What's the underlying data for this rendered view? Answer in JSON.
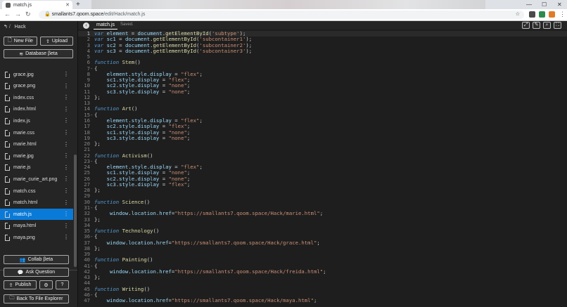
{
  "browser": {
    "tab_title": "match.js",
    "url_host": "smallants7.qoom.space",
    "url_path": "/edit/Hack/match.js"
  },
  "sidebar": {
    "breadcrumb": "Hack",
    "new_file": "New File",
    "upload": "Upload",
    "database": "Database βeta",
    "files": [
      "grace.jpg",
      "grace.png",
      "index.css",
      "index.html",
      "index.js",
      "marie.css",
      "marie.html",
      "marie.jpg",
      "marie.js",
      "marie_curie_art.png",
      "match.css",
      "match.html",
      "match.js",
      "maya.html",
      "maya.png"
    ],
    "active_file": "match.js",
    "collab": "Collab βeta",
    "ask": "Ask Question",
    "publish": "Publish",
    "back_explorer": "Back To File Explorer"
  },
  "editor": {
    "tab": "match.js",
    "status": "Saved.",
    "current_line": 1,
    "lines": [
      [
        [
          "kw",
          "var"
        ],
        [
          "pl",
          " "
        ],
        [
          "id",
          "element"
        ],
        [
          "pl",
          " = "
        ],
        [
          "id",
          "document"
        ],
        [
          "pl",
          "."
        ],
        [
          "fn",
          "getElementById"
        ],
        [
          "pl",
          "("
        ],
        [
          "str",
          "'subtype'"
        ],
        [
          "pl",
          ");"
        ]
      ],
      [
        [
          "kw",
          "var"
        ],
        [
          "pl",
          " "
        ],
        [
          "id",
          "sc1"
        ],
        [
          "pl",
          " = "
        ],
        [
          "id",
          "document"
        ],
        [
          "pl",
          "."
        ],
        [
          "fn",
          "getElementById"
        ],
        [
          "pl",
          "("
        ],
        [
          "str",
          "'subcontainer1'"
        ],
        [
          "pl",
          ");"
        ]
      ],
      [
        [
          "kw",
          "var"
        ],
        [
          "pl",
          " "
        ],
        [
          "id",
          "sc2"
        ],
        [
          "pl",
          " = "
        ],
        [
          "id",
          "document"
        ],
        [
          "pl",
          "."
        ],
        [
          "fn",
          "getElementById"
        ],
        [
          "pl",
          "("
        ],
        [
          "str",
          "'subcontainer2'"
        ],
        [
          "pl",
          ");"
        ]
      ],
      [
        [
          "kw",
          "var"
        ],
        [
          "pl",
          " "
        ],
        [
          "id",
          "sc3"
        ],
        [
          "pl",
          " = "
        ],
        [
          "id",
          "document"
        ],
        [
          "pl",
          "."
        ],
        [
          "fn",
          "getElementById"
        ],
        [
          "pl",
          "("
        ],
        [
          "str",
          "'subcontainer3'"
        ],
        [
          "pl",
          ");"
        ]
      ],
      [],
      [
        [
          "kw",
          "function"
        ],
        [
          "pl",
          " "
        ],
        [
          "fn",
          "Stem"
        ],
        [
          "pl",
          "()"
        ]
      ],
      [
        [
          "pl",
          "{"
        ]
      ],
      [
        [
          "pl",
          "    "
        ],
        [
          "id",
          "element"
        ],
        [
          "pl",
          "."
        ],
        [
          "id",
          "style"
        ],
        [
          "pl",
          "."
        ],
        [
          "id",
          "display"
        ],
        [
          "pl",
          " = "
        ],
        [
          "str",
          "\"flex\""
        ],
        [
          "pl",
          ";"
        ]
      ],
      [
        [
          "pl",
          "    "
        ],
        [
          "id",
          "sc1"
        ],
        [
          "pl",
          "."
        ],
        [
          "id",
          "style"
        ],
        [
          "pl",
          "."
        ],
        [
          "id",
          "display"
        ],
        [
          "pl",
          " = "
        ],
        [
          "str",
          "\"flex\""
        ],
        [
          "pl",
          ";"
        ]
      ],
      [
        [
          "pl",
          "    "
        ],
        [
          "id",
          "sc2"
        ],
        [
          "pl",
          "."
        ],
        [
          "id",
          "style"
        ],
        [
          "pl",
          "."
        ],
        [
          "id",
          "display"
        ],
        [
          "pl",
          " = "
        ],
        [
          "str",
          "\"none\""
        ],
        [
          "pl",
          ";"
        ]
      ],
      [
        [
          "pl",
          "    "
        ],
        [
          "id",
          "sc3"
        ],
        [
          "pl",
          "."
        ],
        [
          "id",
          "style"
        ],
        [
          "pl",
          "."
        ],
        [
          "id",
          "display"
        ],
        [
          "pl",
          " = "
        ],
        [
          "str",
          "\"none\""
        ],
        [
          "pl",
          ";"
        ]
      ],
      [
        [
          "pl",
          "};"
        ]
      ],
      [],
      [
        [
          "kw",
          "function"
        ],
        [
          "pl",
          " "
        ],
        [
          "fn",
          "Art"
        ],
        [
          "pl",
          "()"
        ]
      ],
      [
        [
          "pl",
          "{"
        ]
      ],
      [
        [
          "pl",
          "    "
        ],
        [
          "id",
          "element"
        ],
        [
          "pl",
          "."
        ],
        [
          "id",
          "style"
        ],
        [
          "pl",
          "."
        ],
        [
          "id",
          "display"
        ],
        [
          "pl",
          " = "
        ],
        [
          "str",
          "\"flex\""
        ],
        [
          "pl",
          ";"
        ]
      ],
      [
        [
          "pl",
          "    "
        ],
        [
          "id",
          "sc2"
        ],
        [
          "pl",
          "."
        ],
        [
          "id",
          "style"
        ],
        [
          "pl",
          "."
        ],
        [
          "id",
          "display"
        ],
        [
          "pl",
          " = "
        ],
        [
          "str",
          "\"flex\""
        ],
        [
          "pl",
          ";"
        ]
      ],
      [
        [
          "pl",
          "    "
        ],
        [
          "id",
          "sc1"
        ],
        [
          "pl",
          "."
        ],
        [
          "id",
          "style"
        ],
        [
          "pl",
          "."
        ],
        [
          "id",
          "display"
        ],
        [
          "pl",
          " = "
        ],
        [
          "str",
          "\"none\""
        ],
        [
          "pl",
          ";"
        ]
      ],
      [
        [
          "pl",
          "    "
        ],
        [
          "id",
          "sc3"
        ],
        [
          "pl",
          "."
        ],
        [
          "id",
          "style"
        ],
        [
          "pl",
          "."
        ],
        [
          "id",
          "display"
        ],
        [
          "pl",
          " = "
        ],
        [
          "str",
          "\"none\""
        ],
        [
          "pl",
          ";"
        ]
      ],
      [
        [
          "pl",
          "};"
        ]
      ],
      [],
      [
        [
          "kw",
          "function"
        ],
        [
          "pl",
          " "
        ],
        [
          "fn",
          "Activism"
        ],
        [
          "pl",
          "()"
        ]
      ],
      [
        [
          "pl",
          "{"
        ]
      ],
      [
        [
          "pl",
          "    "
        ],
        [
          "id",
          "element"
        ],
        [
          "pl",
          "."
        ],
        [
          "id",
          "style"
        ],
        [
          "pl",
          "."
        ],
        [
          "id",
          "display"
        ],
        [
          "pl",
          " = "
        ],
        [
          "str",
          "\"flex\""
        ],
        [
          "pl",
          ";"
        ]
      ],
      [
        [
          "pl",
          "    "
        ],
        [
          "id",
          "sc1"
        ],
        [
          "pl",
          "."
        ],
        [
          "id",
          "style"
        ],
        [
          "pl",
          "."
        ],
        [
          "id",
          "display"
        ],
        [
          "pl",
          " = "
        ],
        [
          "str",
          "\"none\""
        ],
        [
          "pl",
          ";"
        ]
      ],
      [
        [
          "pl",
          "    "
        ],
        [
          "id",
          "sc2"
        ],
        [
          "pl",
          "."
        ],
        [
          "id",
          "style"
        ],
        [
          "pl",
          "."
        ],
        [
          "id",
          "display"
        ],
        [
          "pl",
          " = "
        ],
        [
          "str",
          "\"none\""
        ],
        [
          "pl",
          ";"
        ]
      ],
      [
        [
          "pl",
          "    "
        ],
        [
          "id",
          "sc3"
        ],
        [
          "pl",
          "."
        ],
        [
          "id",
          "style"
        ],
        [
          "pl",
          "."
        ],
        [
          "id",
          "display"
        ],
        [
          "pl",
          " = "
        ],
        [
          "str",
          "\"flex\""
        ],
        [
          "pl",
          ";"
        ]
      ],
      [
        [
          "pl",
          "};"
        ]
      ],
      [],
      [
        [
          "kw",
          "function"
        ],
        [
          "pl",
          " "
        ],
        [
          "fn",
          "Science"
        ],
        [
          "pl",
          "()"
        ]
      ],
      [
        [
          "pl",
          "{"
        ]
      ],
      [
        [
          "pl",
          "     "
        ],
        [
          "id",
          "window"
        ],
        [
          "pl",
          "."
        ],
        [
          "id",
          "location"
        ],
        [
          "pl",
          "."
        ],
        [
          "id",
          "href"
        ],
        [
          "pl",
          "="
        ],
        [
          "str",
          "\"https://smallants7.qoom.space/Hack/marie.html\""
        ],
        [
          "pl",
          ";"
        ]
      ],
      [
        [
          "pl",
          "};"
        ]
      ],
      [],
      [
        [
          "kw",
          "function"
        ],
        [
          "pl",
          " "
        ],
        [
          "fn",
          "Technology"
        ],
        [
          "pl",
          "()"
        ]
      ],
      [
        [
          "pl",
          "{"
        ]
      ],
      [
        [
          "pl",
          "    "
        ],
        [
          "id",
          "window"
        ],
        [
          "pl",
          "."
        ],
        [
          "id",
          "location"
        ],
        [
          "pl",
          "."
        ],
        [
          "id",
          "href"
        ],
        [
          "pl",
          "="
        ],
        [
          "str",
          "\"https://smallants7.qoom.space/Hack/grace.html\""
        ],
        [
          "pl",
          ";"
        ]
      ],
      [
        [
          "pl",
          "};"
        ]
      ],
      [],
      [
        [
          "kw",
          "function"
        ],
        [
          "pl",
          " "
        ],
        [
          "fn",
          "Painting"
        ],
        [
          "pl",
          "()"
        ]
      ],
      [
        [
          "pl",
          "{"
        ]
      ],
      [
        [
          "pl",
          "     "
        ],
        [
          "id",
          "window"
        ],
        [
          "pl",
          "."
        ],
        [
          "id",
          "location"
        ],
        [
          "pl",
          "."
        ],
        [
          "id",
          "href"
        ],
        [
          "pl",
          "="
        ],
        [
          "str",
          "\"https://smallants7.qoom.space/Hack/freida.html\""
        ],
        [
          "pl",
          ";"
        ]
      ],
      [
        [
          "pl",
          "};"
        ]
      ],
      [],
      [
        [
          "kw",
          "function"
        ],
        [
          "pl",
          " "
        ],
        [
          "fn",
          "Writing"
        ],
        [
          "pl",
          "()"
        ]
      ],
      [
        [
          "pl",
          "{"
        ]
      ],
      [
        [
          "pl",
          "    "
        ],
        [
          "id",
          "window"
        ],
        [
          "pl",
          "."
        ],
        [
          "id",
          "location"
        ],
        [
          "pl",
          "."
        ],
        [
          "id",
          "href"
        ],
        [
          "pl",
          "="
        ],
        [
          "str",
          "\"https://smallants7.qoom.space/Hack/maya.html\""
        ],
        [
          "pl",
          ";"
        ]
      ]
    ],
    "fold_lines": [
      7,
      15,
      23,
      31,
      36,
      41,
      46
    ]
  },
  "icons": [
    "back-arrow-icon",
    "forward-arrow-icon",
    "reload-icon",
    "lock-icon",
    "star-icon",
    "menu-dots-icon",
    "file-icon",
    "kebab-icon",
    "users-icon",
    "chat-icon",
    "gear-icon",
    "help-icon"
  ]
}
